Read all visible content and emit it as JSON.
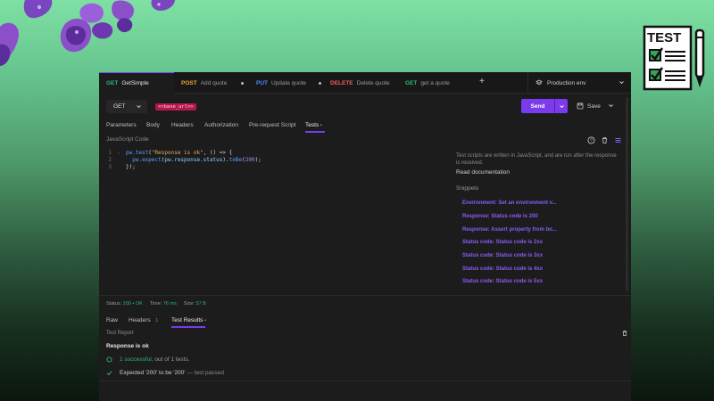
{
  "tabs": [
    {
      "method": "GET",
      "name": "GetSimple",
      "active": true
    },
    {
      "method": "POST",
      "name": "Add quote"
    },
    {
      "method": "PUT",
      "name": "Update quote"
    },
    {
      "method": "DELETE",
      "name": "Delete quote"
    },
    {
      "method": "GET",
      "name": "get a quote"
    }
  ],
  "environment": "Production env",
  "request": {
    "method": "GET",
    "url_variable": "<<base_url>>",
    "send_label": "Send",
    "save_label": "Save"
  },
  "request_tabs": [
    "Parameters",
    "Body",
    "Headers",
    "Authorization",
    "Pre-request Script",
    "Tests"
  ],
  "editor": {
    "language_label": "JavaScript Code",
    "line_numbers": [
      "1",
      "2",
      "3"
    ]
  },
  "side_panel": {
    "description": "Test scripts are written in JavaScript, and are run after the response is received.",
    "read_docs": "Read documentation",
    "snippets_label": "Snippets",
    "snippets": [
      "Environment: Set an environment v...",
      "Response: Status code is 200",
      "Response: Assert property from bo...",
      "Status code: Status code is 2xx",
      "Status code: Status code is 3xx",
      "Status code: Status code is 4xx",
      "Status code: Status code is 5xx"
    ]
  },
  "response": {
    "status_label": "Status:",
    "status_value": "200 • OK",
    "time_label": "Time:",
    "time_value": "76 ms",
    "size_label": "Size:",
    "size_value": "57 B",
    "tabs": [
      "Raw",
      "Headers",
      "Test Results"
    ],
    "headers_count": "1",
    "report_label": "Test Report",
    "result_title": "Response is ok",
    "summary_success": "1 successful,",
    "summary_rest": "out of 1 tests.",
    "test_expectation": "Expected '200' to be '200'",
    "test_dash": "—",
    "test_status": "test passed"
  },
  "badge": {
    "text": "TEST"
  },
  "colors": {
    "accent": "#7c3aed",
    "get": "#2bb673",
    "post": "#e8a33d",
    "put": "#4c8df6",
    "delete": "#ef5b5b",
    "background_top": "#7fe0a4",
    "panel": "#1c1c1c"
  },
  "icons": [
    "layers-icon",
    "chevron-down-icon",
    "plus-icon",
    "save-icon",
    "help-icon",
    "trash-icon",
    "list-icon",
    "circle-icon",
    "check-icon",
    "test-checklist-icon"
  ]
}
